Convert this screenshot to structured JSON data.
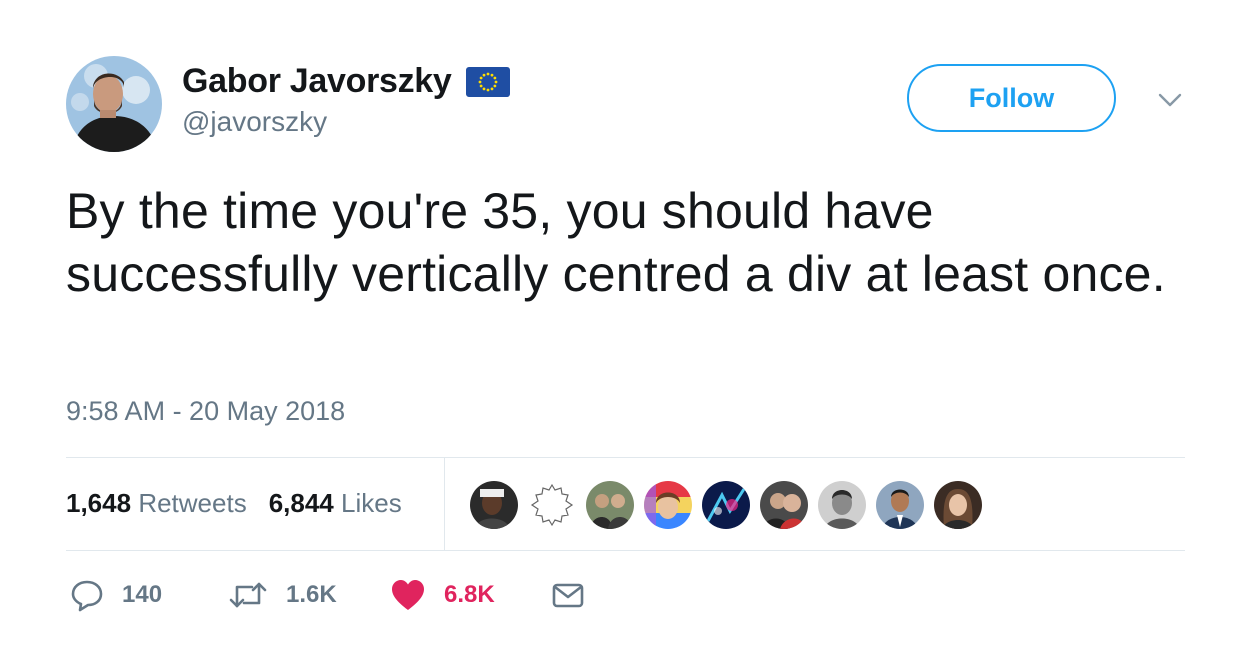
{
  "author": {
    "name": "Gabor Javorszky",
    "handle": "@javorszky",
    "flag_icon": "eu-flag-icon",
    "avatar": "profile-photo"
  },
  "follow_button": {
    "label": "Follow"
  },
  "menu_icon": "chevron-down-icon",
  "tweet": {
    "text": "By the time you're 35, you should have successfully vertically centred a div at least once.",
    "timestamp": "9:58 AM - 20 May 2018"
  },
  "stats": {
    "retweets": {
      "value": "1,648",
      "label": "Retweets"
    },
    "likes": {
      "value": "6,844",
      "label": "Likes"
    }
  },
  "likers": [
    {
      "name": "liker-avatar-1"
    },
    {
      "name": "liker-avatar-2"
    },
    {
      "name": "liker-avatar-3"
    },
    {
      "name": "liker-avatar-4"
    },
    {
      "name": "liker-avatar-5"
    },
    {
      "name": "liker-avatar-6"
    },
    {
      "name": "liker-avatar-7"
    },
    {
      "name": "liker-avatar-8"
    },
    {
      "name": "liker-avatar-9"
    }
  ],
  "actions": {
    "reply": {
      "icon": "reply-icon",
      "count": "140"
    },
    "retweet": {
      "icon": "retweet-icon",
      "count": "1.6K"
    },
    "like": {
      "icon": "heart-icon",
      "count": "6.8K"
    },
    "dm": {
      "icon": "envelope-icon"
    }
  },
  "colors": {
    "accent": "#1da1f2",
    "like": "#e0245e",
    "muted": "#657786",
    "text": "#14171a",
    "border": "#e1e8ed"
  }
}
